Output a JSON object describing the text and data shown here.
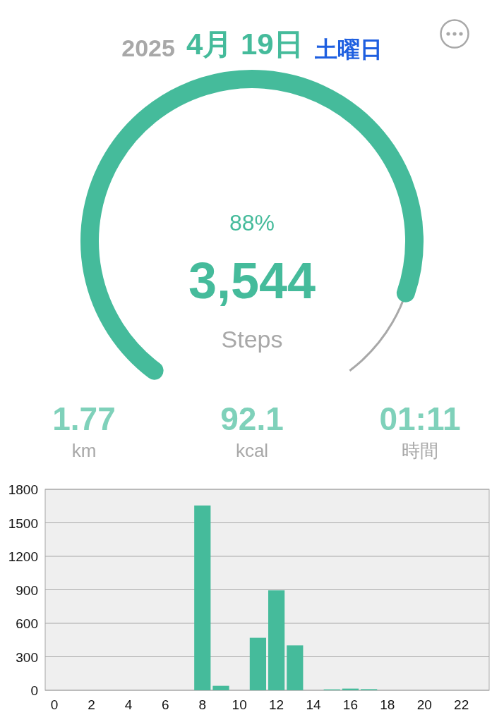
{
  "header": {
    "year": "2025",
    "date": "4月 19日",
    "weekday": "土曜日"
  },
  "gauge": {
    "percent": "88%",
    "steps": "3,544",
    "unit": "Steps"
  },
  "stats": [
    {
      "value": "1.77",
      "label": "km"
    },
    {
      "value": "92.1",
      "label": "kcal"
    },
    {
      "value": "01:11",
      "label": "時間"
    }
  ],
  "chart": {
    "chart_data": {
      "type": "bar",
      "x": [
        8,
        9,
        11,
        12,
        13,
        15,
        16,
        17
      ],
      "grid": true,
      "series": [
        {
          "color": "#45bb9b",
          "values": [
            1655,
            40,
            470,
            895,
            402,
            8,
            15,
            10
          ]
        }
      ],
      "xlim": [
        -0.5,
        23.5
      ],
      "ylim": [
        0,
        1800
      ],
      "yticks": [
        0,
        300,
        600,
        900,
        1200,
        1500,
        1800
      ],
      "xticks": [
        0,
        2,
        4,
        6,
        8,
        10,
        12,
        14,
        16,
        18,
        20,
        22
      ]
    }
  }
}
